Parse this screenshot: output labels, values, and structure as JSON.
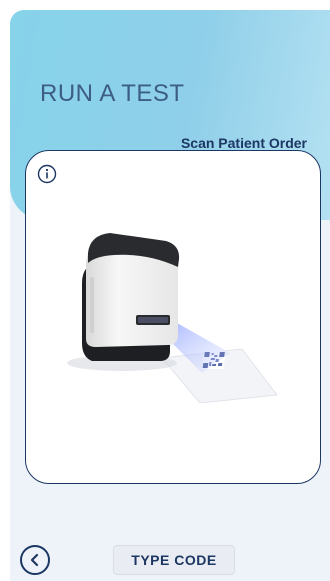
{
  "header": {
    "title": "RUN A TEST",
    "subtitle": "Scan Patient Order"
  },
  "card": {
    "info_icon": "info-icon",
    "illustration": "scanner-scanning-qr-code-image"
  },
  "footer": {
    "back_icon": "chevron-left-icon",
    "type_code_label": "TYPE CODE"
  },
  "colors": {
    "header_gradient_start": "#86d3ea",
    "header_gradient_end": "#b4e1f2",
    "title": "#3d5d87",
    "accent_navy": "#1d3763",
    "background": "#eef3fa"
  }
}
